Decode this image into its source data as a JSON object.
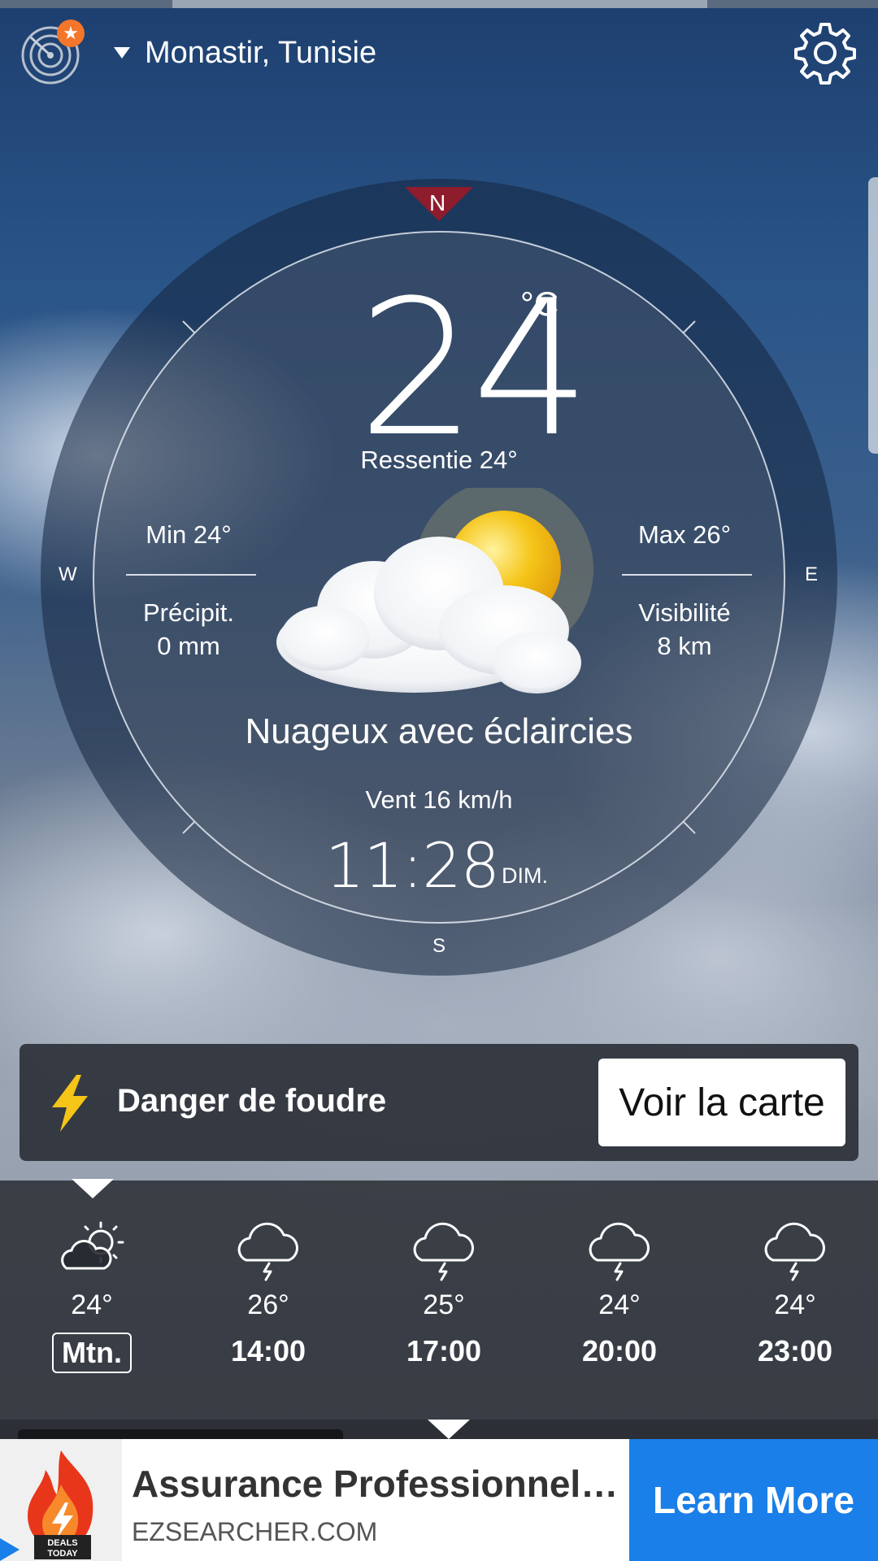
{
  "location": {
    "name": "Monastir, Tunisie"
  },
  "current": {
    "temperature": "24",
    "unit": "°C",
    "feels_like": "Ressentie 24°",
    "min": "Min 24°",
    "max": "Max 26°",
    "precip_label": "Précipit.",
    "precip_value": "0 mm",
    "visibility_label": "Visibilité",
    "visibility_value": "8 km",
    "condition": "Nuageux avec éclaircies",
    "wind": "Vent 16 km/h",
    "time": "11:28",
    "day": "DIM."
  },
  "compass": {
    "north": "N",
    "south": "S",
    "east": "E",
    "west": "W"
  },
  "alert": {
    "label": "Danger de foudre",
    "button": "Voir la carte"
  },
  "hourly": [
    {
      "temp": "24°",
      "hour": "Mtn.",
      "icon": "partly-sunny-icon"
    },
    {
      "temp": "26°",
      "hour": "14:00",
      "icon": "thunder-cloud-icon"
    },
    {
      "temp": "25°",
      "hour": "17:00",
      "icon": "thunder-cloud-icon"
    },
    {
      "temp": "24°",
      "hour": "20:00",
      "icon": "thunder-cloud-icon"
    },
    {
      "temp": "24°",
      "hour": "23:00",
      "icon": "thunder-cloud-icon"
    }
  ],
  "ad": {
    "title": "Assurance Professionnelle Pas Chère",
    "url": "EZSEARCHER.COM",
    "cta": "Learn More",
    "badge_line1": "DEALS",
    "badge_line2": "TODAY"
  },
  "colors": {
    "accent_orange": "#f3762b",
    "north_marker": "#8e1c2c",
    "cta_blue": "#1a7fe8",
    "bolt_yellow": "#f5c518"
  }
}
